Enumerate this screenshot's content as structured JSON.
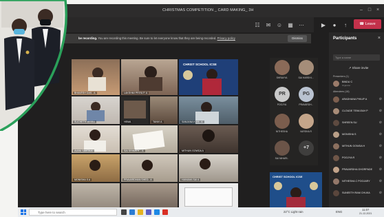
{
  "window": {
    "title": "CHRISTMAS COMPETITION _ CARD MAKING_ 3H"
  },
  "toolbar": {
    "leave_label": "Leave",
    "icons": [
      "participants-icon",
      "chat-icon",
      "reactions-icon",
      "rooms-icon",
      "more-icon",
      "camera-icon",
      "mic-icon",
      "share-icon"
    ]
  },
  "recording_bar": {
    "bold": "be recording.",
    "text": " You are recording this meeting. Be sure to let everyone know that they are being recorded.",
    "link": "Privacy policy",
    "dismiss_label": "Dismiss"
  },
  "video_tiles": [
    {
      "name": "BHAVESH DAS.. A"
    },
    {
      "name": "LAKSHMI PRIYA P. A"
    },
    {
      "name": "CHRIST SCHOOL ICSE"
    },
    {
      "name": "SUCHETH MISRA"
    },
    {
      "name": "HEMA"
    },
    {
      "name": "TANVI A"
    },
    {
      "name": "SAI SRINATH .. A"
    },
    {
      "name": "SANJANA KUM.. A"
    },
    {
      "name": "AVANI SAVITA A"
    },
    {
      "name": ""
    },
    {
      "name": "MITHUN GOWDA A"
    },
    {
      "name": "HANUMA SAI A"
    },
    {
      "name": "MONISHA S A"
    },
    {
      "name": "PRAVARDHAN SHED.. A"
    },
    {
      "name": "SAI HARSHITH A"
    },
    {
      "name": ""
    }
  ],
  "gallery": [
    {
      "name": "SHRAVYA",
      "initials": ""
    },
    {
      "name": "SAI HARSHI...",
      "initials": ""
    },
    {
      "name": "POOJYA",
      "initials": "PR"
    },
    {
      "name": "PRAVARDH..",
      "initials": "PG"
    },
    {
      "name": "NITHESHA",
      "initials": ""
    },
    {
      "name": "VARSHA R",
      "initials": ""
    },
    {
      "name": "SAI NIHARI..",
      "initials": ""
    },
    {
      "name": "",
      "initials": "+7"
    }
  ],
  "bottom_card": {
    "title": "CHRIST SCHOOL ICSE"
  },
  "participants_panel": {
    "title": "Participants",
    "search_placeholder": "Type a name",
    "share_invite_label": "Share invite",
    "presenters_label": "Presenters (1)",
    "attendees_label": "Attendees (18)",
    "presenter": {
      "name": "BINDU C",
      "sub": "Organizer"
    },
    "attendees": [
      "ARADHANA PHILIP A",
      "CLOUDE TEWLEAH P",
      "SHREEN SU",
      "MONISHA S",
      "MITHUN GOWDA H",
      "POOJYA R",
      "PRAVARDHA GHORPADE",
      "NITHESHA C POOJARY",
      "SUNEETH RAM CHUKA"
    ]
  },
  "taskbar": {
    "search_placeholder": "Type here to search",
    "weather": "22°C  Light rain",
    "time": "11:07",
    "date": "21-12-2021",
    "lang": "ENG"
  },
  "colors": {
    "teams_bg": "#201f1f",
    "leave_red": "#c4314b",
    "taskbar": "#e9ecef",
    "frame_green": "#2aa05a"
  }
}
